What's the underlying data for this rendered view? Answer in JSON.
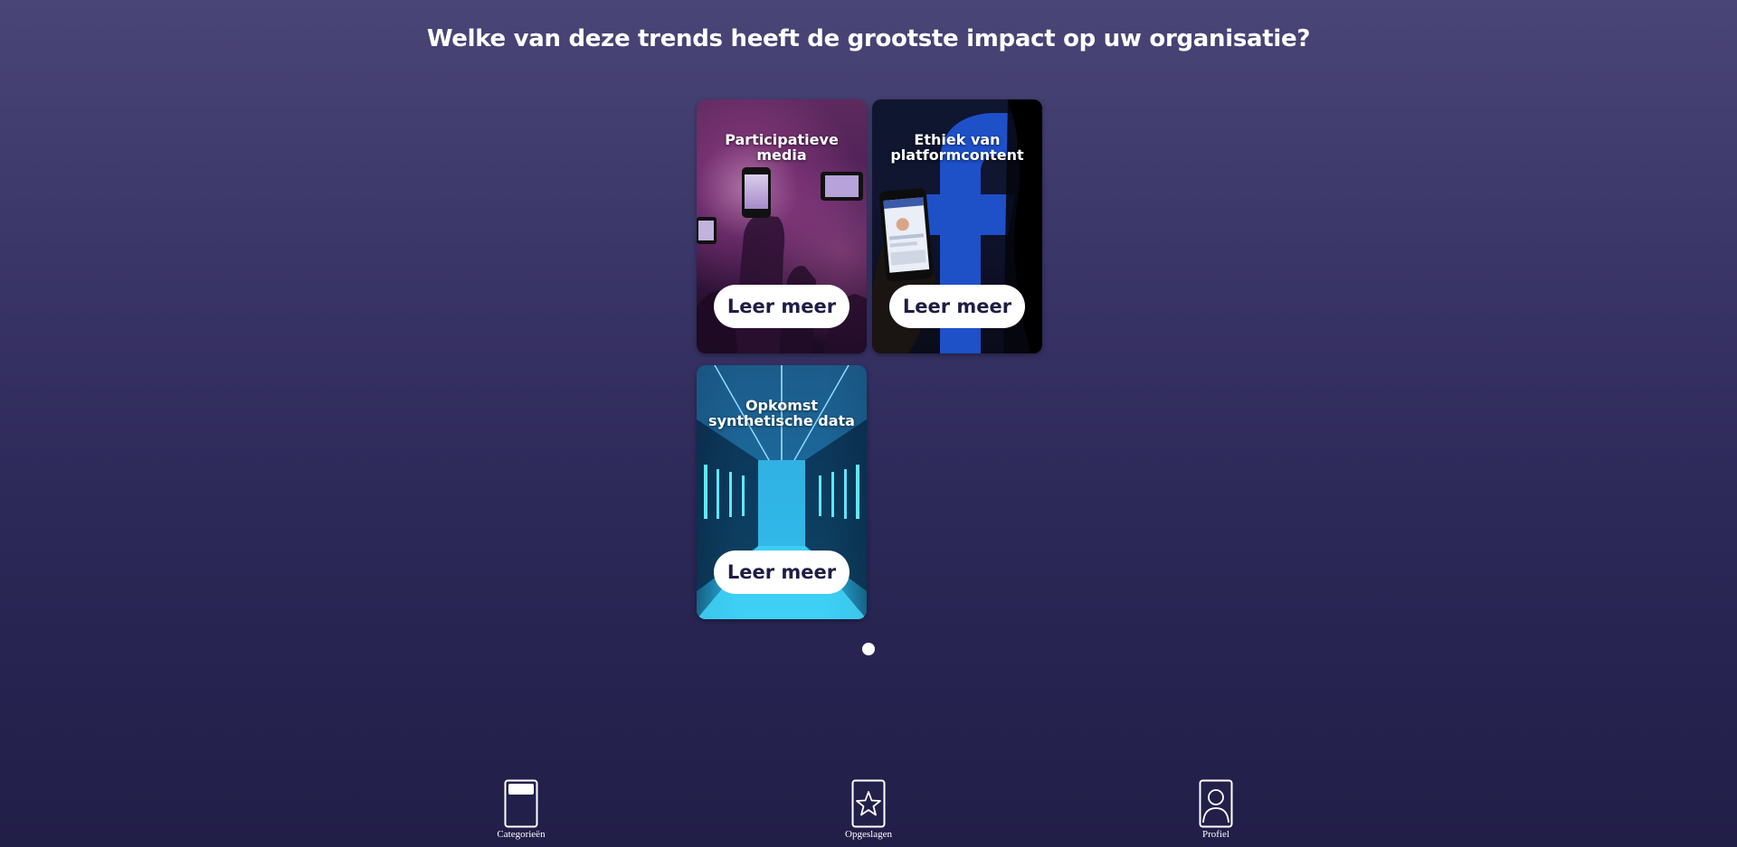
{
  "question": "Welke van deze trends heeft de grootste impact op uw organisatie?",
  "cards": [
    {
      "title": "Participatieve media",
      "button": "Leer meer",
      "image": "concert-phones-photo"
    },
    {
      "title": "Ethiek van platformcontent",
      "button": "Leer meer",
      "image": "facebook-phone-photo"
    },
    {
      "title": "Opkomst synthetische data",
      "button": "Leer meer",
      "image": "server-room-photo"
    }
  ],
  "pagination": {
    "pages": 1,
    "current": 1
  },
  "nav": {
    "items": [
      {
        "label": "Categorieën",
        "icon": "categories-icon"
      },
      {
        "label": "Opgeslagen",
        "icon": "star-icon"
      },
      {
        "label": "Profiel",
        "icon": "profile-icon"
      }
    ]
  },
  "colors": {
    "background_top": "#4a4577",
    "background_bottom": "#211e48",
    "button_text": "#1f1d45",
    "facebook_blue": "#1e50c8"
  }
}
